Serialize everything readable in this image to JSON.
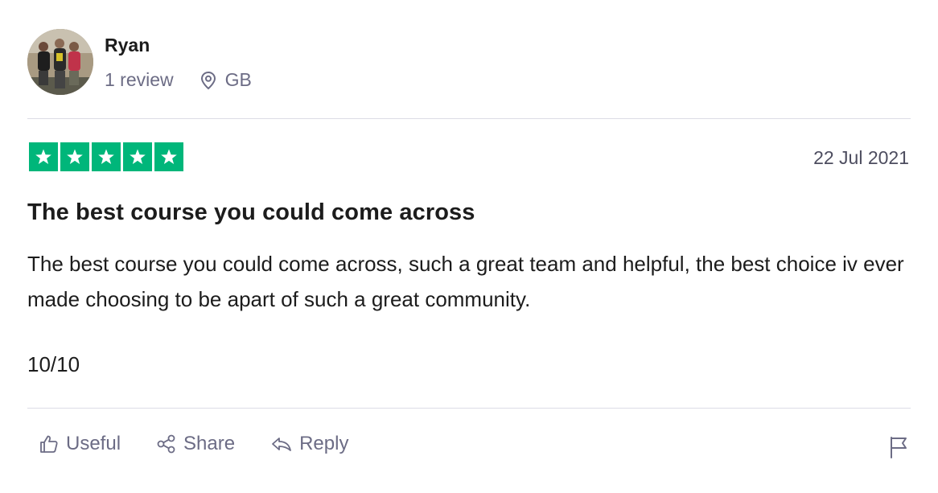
{
  "reviewer": {
    "name": "Ryan",
    "review_count": "1 review",
    "country": "GB"
  },
  "review": {
    "rating": 5,
    "rating_max": 5,
    "star_color": "#00b67a",
    "date": "22 Jul 2021",
    "title": "The best course you could come across",
    "body": "The best course you could come across, such a great team and helpful, the best choice iv ever made choosing to be apart of such a great community.",
    "score_text": "10/10"
  },
  "actions": {
    "useful_label": "Useful",
    "share_label": "Share",
    "reply_label": "Reply"
  },
  "icons": [
    "location-pin-icon",
    "star-icon",
    "thumbs-up-icon",
    "share-icon",
    "reply-icon",
    "flag-icon"
  ]
}
